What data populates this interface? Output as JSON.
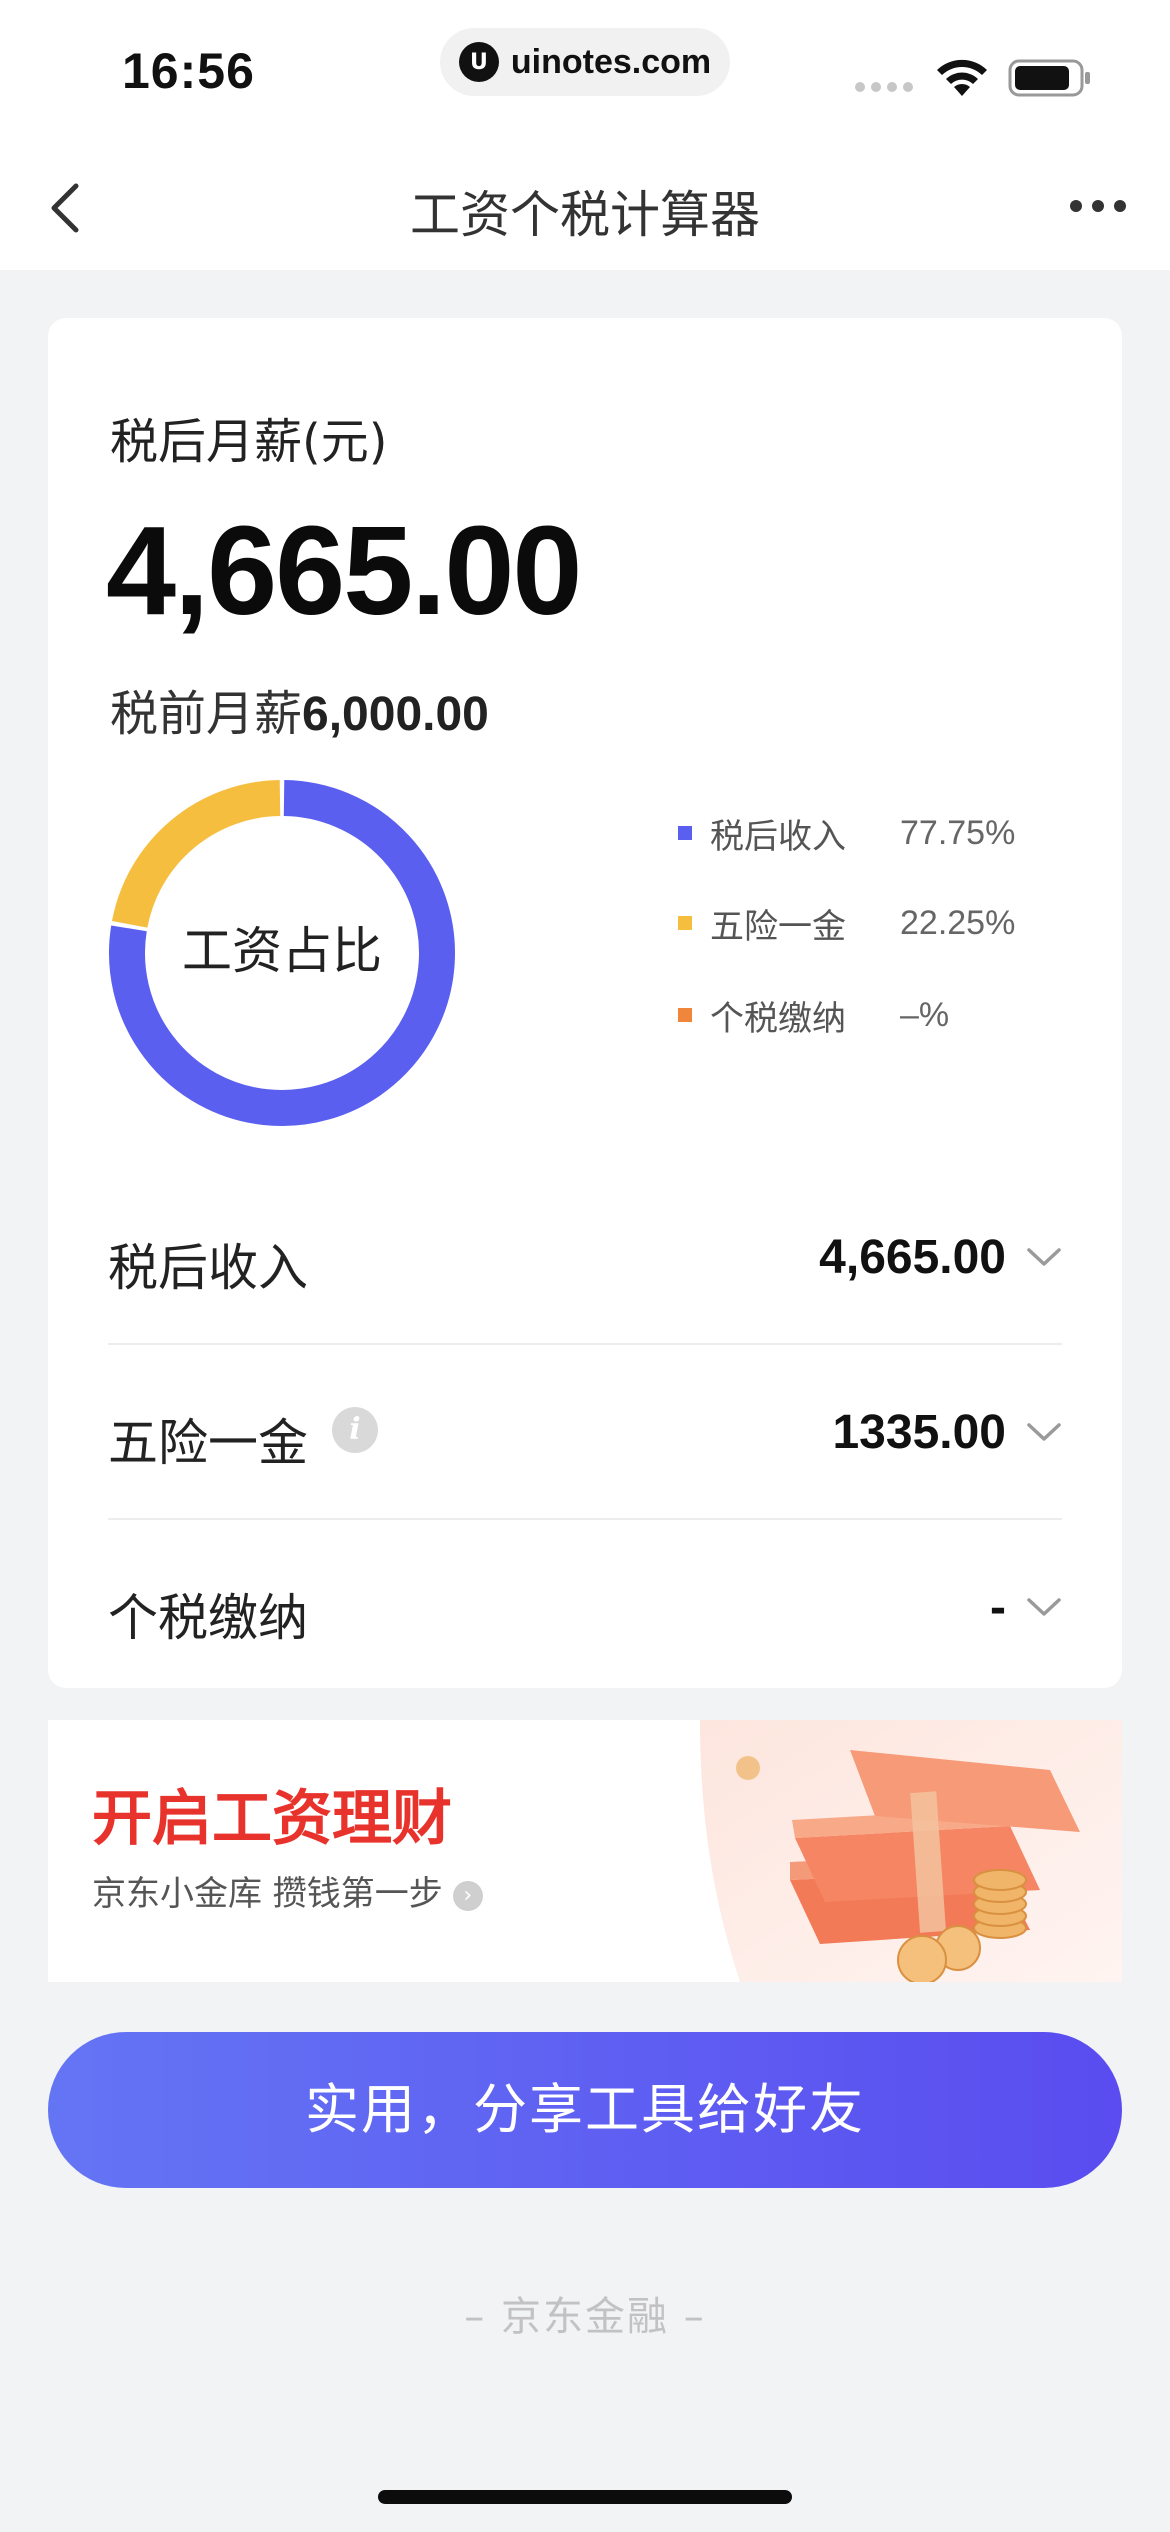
{
  "status_bar": {
    "time": "16:56",
    "url": "uinotes.com"
  },
  "nav": {
    "title": "工资个税计算器"
  },
  "summary": {
    "after_tax_label": "税后月薪(元)",
    "after_tax_value": "4,665.00",
    "pre_tax_prefix": "税前月薪",
    "pre_tax_value": "6,000.00"
  },
  "chart_data": {
    "type": "pie",
    "center_label": "工资占比",
    "categories": [
      "税后收入",
      "五险一金",
      "个税缴纳"
    ],
    "values": [
      77.75,
      22.25,
      0
    ],
    "value_labels": [
      "77.75%",
      "22.25%",
      "–%"
    ],
    "colors": [
      "#5b5ff0",
      "#f6be3e",
      "#f0863b"
    ]
  },
  "breakdown": {
    "after_tax": {
      "label": "税后收入",
      "value": "4,665.00"
    },
    "insurance": {
      "label": "五险一金",
      "value": "1335.00",
      "info_glyph": "i"
    },
    "tax": {
      "label": "个税缴纳",
      "value": "-"
    }
  },
  "banner": {
    "title": "开启工资理财",
    "subtitle": "京东小金库 攒钱第一步",
    "arrow": "›"
  },
  "share_button": "实用，分享工具给好友",
  "footer": "– 京东金融 –",
  "icons": {
    "back": "chevron-left-icon",
    "more": "more-dots-icon",
    "wifi": "wifi-icon",
    "battery": "battery-icon",
    "info": "info-icon",
    "chevron": "chevron-down-icon"
  }
}
